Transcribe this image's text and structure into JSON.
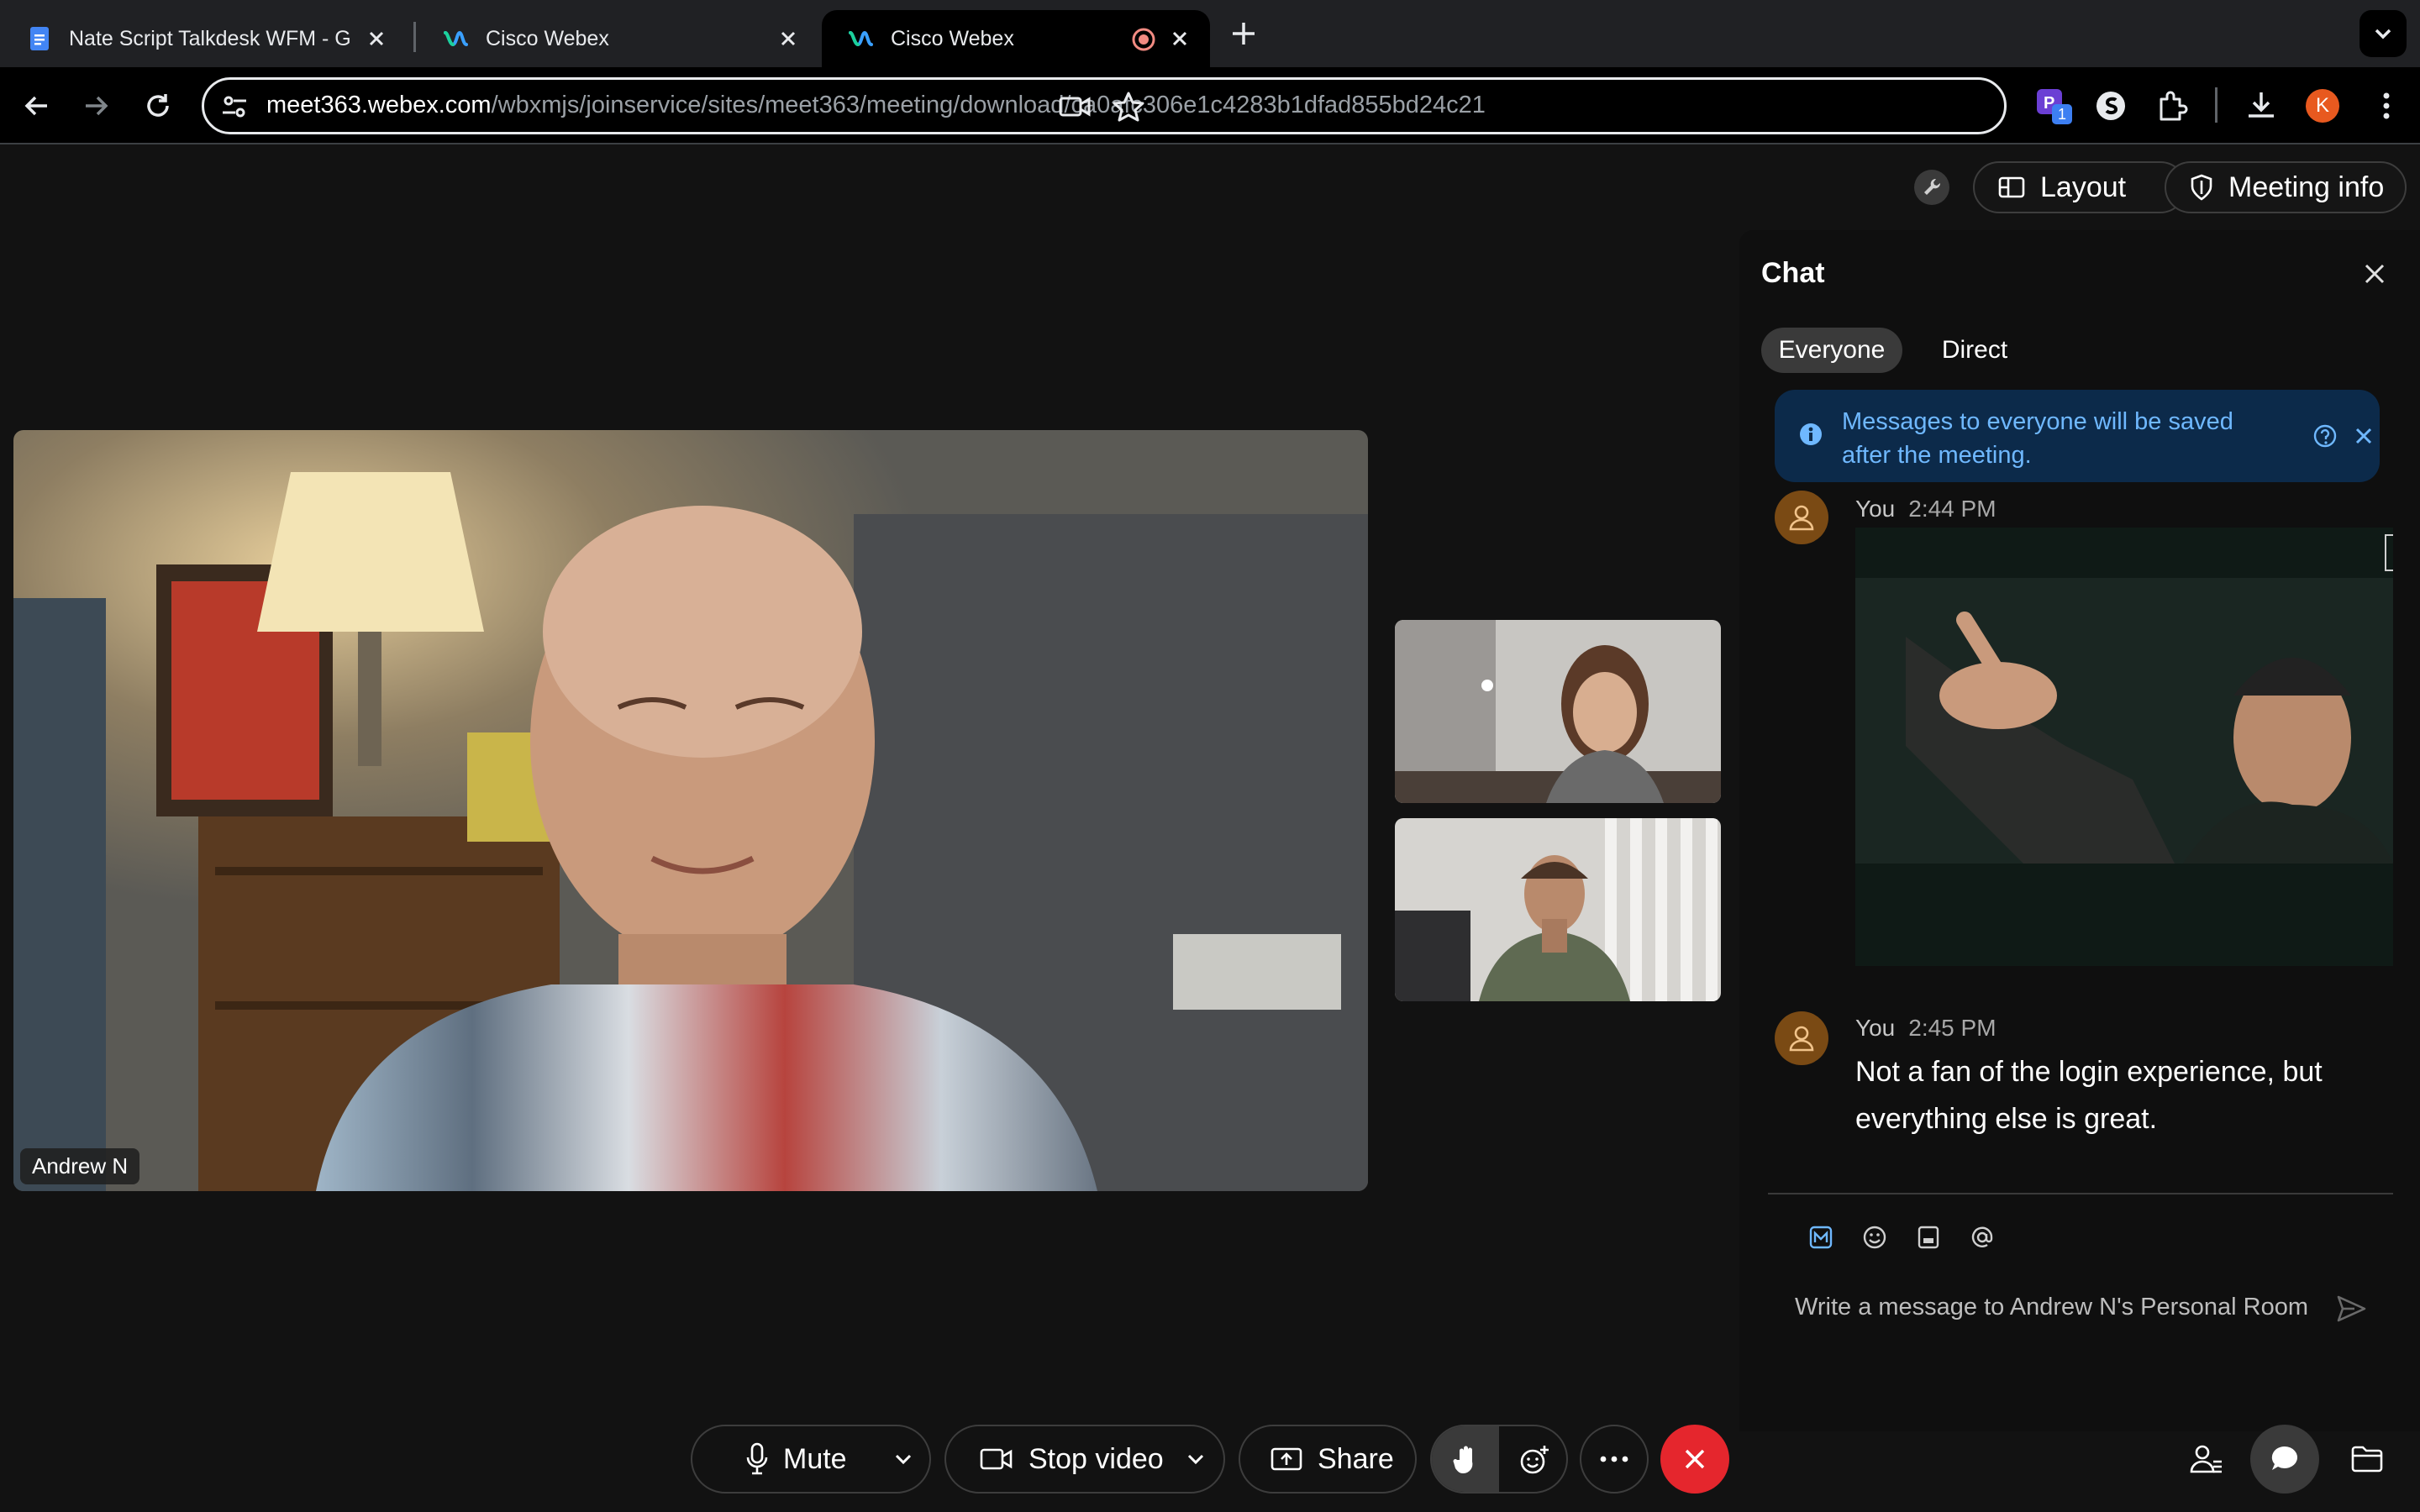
{
  "browser": {
    "tabs": [
      {
        "title": "Nate Script Talkdesk WFM - G",
        "favicon": "google-docs-icon"
      },
      {
        "title": "Cisco Webex",
        "favicon": "webex-icon"
      },
      {
        "title": "Cisco Webex",
        "favicon": "webex-icon",
        "active": true,
        "recording": true
      }
    ],
    "url_host": "meet363.webex.com",
    "url_path": "/wbxmjs/joinservice/sites/meet363/meeting/download/ca0afc306e1c4283b1dfad855bd24c21",
    "profile_initial": "K",
    "extension_badge": "1"
  },
  "meeting": {
    "layout_label": "Layout",
    "meeting_info_label": "Meeting info",
    "main_participant": "Andrew N"
  },
  "chat": {
    "title": "Chat",
    "tabs": [
      "Everyone",
      "Direct"
    ],
    "info_banner": "Messages to everyone will be saved after the meeting.",
    "messages": [
      {
        "sender": "You",
        "time": "2:44 PM",
        "type": "gif"
      },
      {
        "sender": "You",
        "time": "2:45 PM",
        "text": "Not a fan of the login experience, but everything else is great."
      }
    ],
    "input_placeholder": "Write a message to Andrew N's Personal Room"
  },
  "controls": {
    "mute_label": "Mute",
    "stop_video_label": "Stop video",
    "share_label": "Share"
  },
  "colors": {
    "accent": "#6fb8ff",
    "end_call": "#e5262d",
    "avatar": "#7a4a14",
    "background": "#121212"
  }
}
